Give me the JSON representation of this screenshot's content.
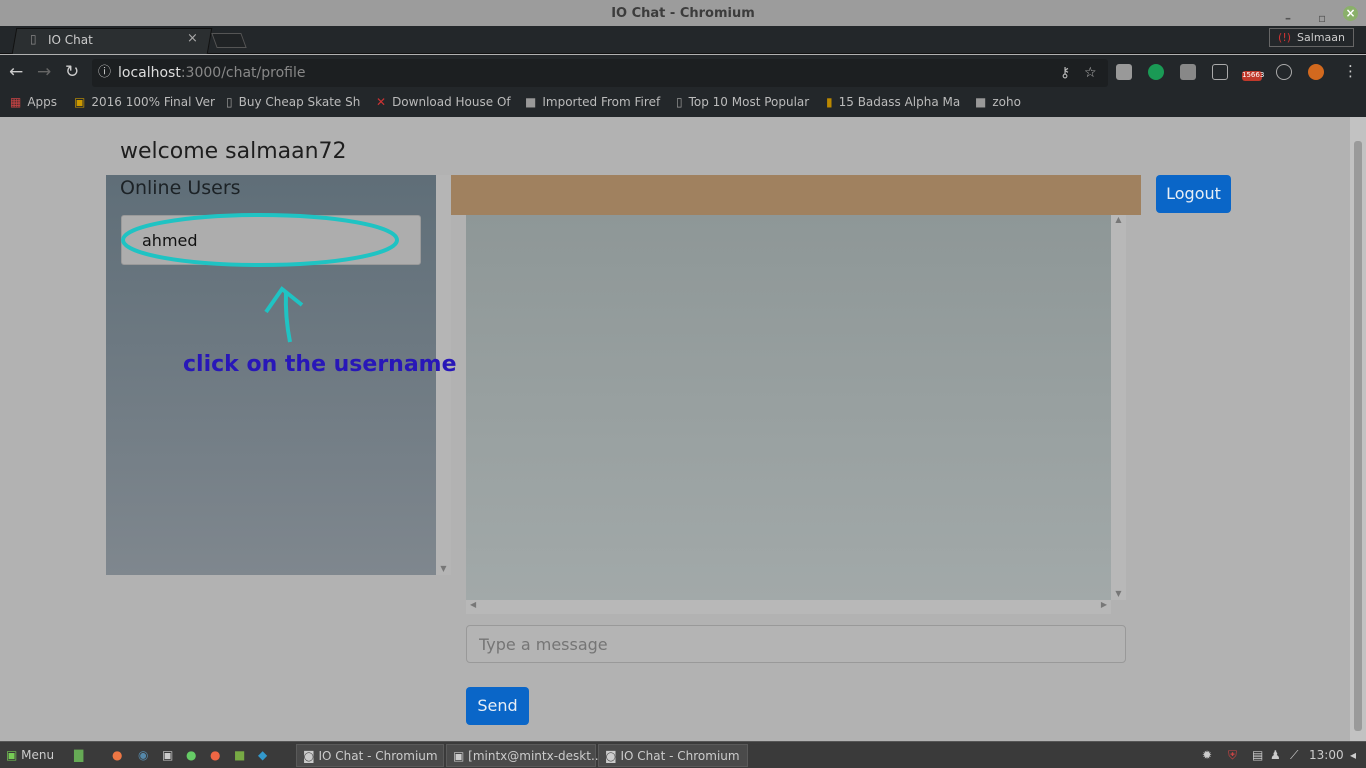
{
  "window": {
    "title": "IO Chat - Chromium",
    "profile": "Salmaan"
  },
  "tab": {
    "title": "IO Chat"
  },
  "address": {
    "host": "localhost",
    "path": ":3000/chat/profile"
  },
  "bookmarks": [
    "Apps",
    "2016 100% Final Ver",
    "Buy Cheap Skate Sh",
    "Download House Of",
    "Imported From Firef",
    "Top 10 Most Popular",
    "15 Badass Alpha Ma",
    "zoho"
  ],
  "extensions": {
    "mail_count": "15663"
  },
  "page": {
    "welcome": "welcome salmaan72",
    "online_users_heading": "Online Users",
    "users": [
      "ahmed"
    ],
    "annotation": "click on the username",
    "logout": "Logout",
    "message_placeholder": "Type a message",
    "send": "Send"
  },
  "taskbar": {
    "menu": "Menu",
    "tasks": [
      "IO Chat - Chromium",
      "[mintx@mintx-deskt...",
      "IO Chat - Chromium"
    ],
    "clock": "13:00"
  },
  "colors": {
    "accent": "#0a66c8",
    "chat_header": "#a0815f",
    "annotation": "#2817b8",
    "highlight": "#1fc3c3"
  }
}
